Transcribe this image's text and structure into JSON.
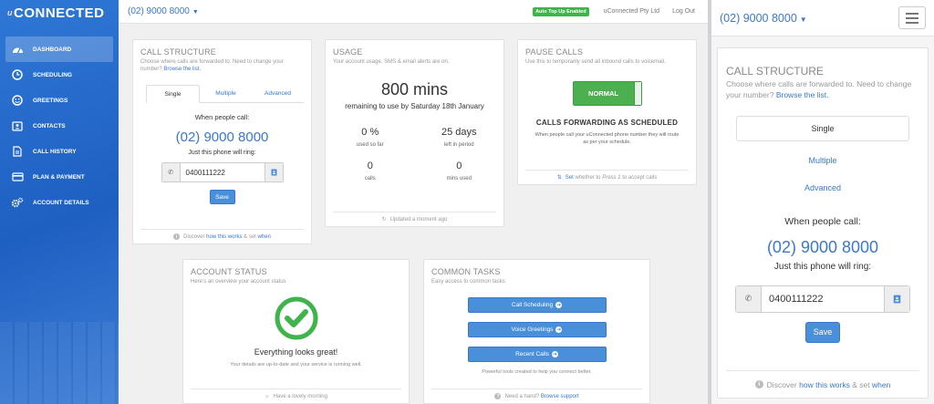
{
  "brand": {
    "logo_text": "CONNECTED",
    "logo_prefix": "u"
  },
  "sidebar": {
    "items": [
      {
        "label": "DASHBOARD",
        "icon": "dashboard-gauge-icon"
      },
      {
        "label": "SCHEDULING",
        "icon": "clock-icon"
      },
      {
        "label": "GREETINGS",
        "icon": "smiley-icon"
      },
      {
        "label": "CONTACTS",
        "icon": "contact-card-icon"
      },
      {
        "label": "CALL HISTORY",
        "icon": "document-icon"
      },
      {
        "label": "PLAN & PAYMENT",
        "icon": "credit-card-icon"
      },
      {
        "label": "ACCOUNT DETAILS",
        "icon": "gears-icon"
      }
    ]
  },
  "topbar": {
    "phone": "(02) 9000 8000",
    "badge": "Auto Top Up Enabled",
    "company": "uConnected Pty Ltd",
    "logout": "Log Out"
  },
  "call_structure": {
    "title": "CALL STRUCTURE",
    "subtitle": "Choose where calls are forwarded to. Need to change your number?",
    "browse": "Browse the list.",
    "tabs": [
      "Single",
      "Multiple",
      "Advanced"
    ],
    "when": "When people call:",
    "number": "(02) 9000 8000",
    "ring": "Just this phone will ring:",
    "phone_value": "0400111222",
    "save": "Save",
    "footer_pre": "Discover",
    "footer_link1": "how this works",
    "footer_mid": "& set",
    "footer_link2": "when"
  },
  "usage": {
    "title": "USAGE",
    "subtitle": "Your account usage. SMS & email alerts are on.",
    "big": "800 mins",
    "remaining": "remaining to use by Saturday 18th January",
    "stats": [
      {
        "value": "0 %",
        "label": "used so far"
      },
      {
        "value": "25 days",
        "label": "left in period"
      },
      {
        "value": "0",
        "label": "calls"
      },
      {
        "value": "0",
        "label": "mins used"
      }
    ],
    "footer": "Updated a moment ago"
  },
  "pause": {
    "title": "PAUSE CALLS",
    "subtitle": "Use this to temporarily send all inbound calls to voicemail.",
    "toggle": "NORMAL",
    "status": "CALLS FORWARDING AS SCHEDULED",
    "status_sub": "When people call your uConnected phone number they will route as per your schedule.",
    "footer_link": "Set",
    "footer_text": "whether to",
    "footer_em": "Press 1",
    "footer_end": "to accept calls"
  },
  "account_status": {
    "title": "ACCOUNT STATUS",
    "subtitle": "Here's an overview your account status",
    "great": "Everything looks great!",
    "great_sub": "Your details are up-to-date and your service is running well.",
    "footer": "Have a lovely morning",
    "check_color": "#3eb54a"
  },
  "tasks": {
    "title": "COMMON TASKS",
    "subtitle": "Easy access to common tasks",
    "buttons": [
      "Call Scheduling",
      "Voice Greetings",
      "Recent Calls"
    ],
    "sub": "Powerful tools created to help you connect better.",
    "footer_pre": "Need a hand?",
    "footer_link": "Browse support"
  },
  "mobile": {
    "phone": "(02) 9000 8000",
    "title": "CALL STRUCTURE",
    "subtitle": "Choose where calls are forwarded to. Need to change your number?",
    "browse": "Browse the list.",
    "tabs": [
      "Single",
      "Multiple",
      "Advanced"
    ],
    "when": "When people call:",
    "number": "(02) 9000 8000",
    "ring": "Just this phone will ring:",
    "phone_value": "0400111222",
    "save": "Save",
    "footer_pre": "Discover",
    "footer_link1": "how this works",
    "footer_mid": "& set",
    "footer_link2": "when"
  }
}
